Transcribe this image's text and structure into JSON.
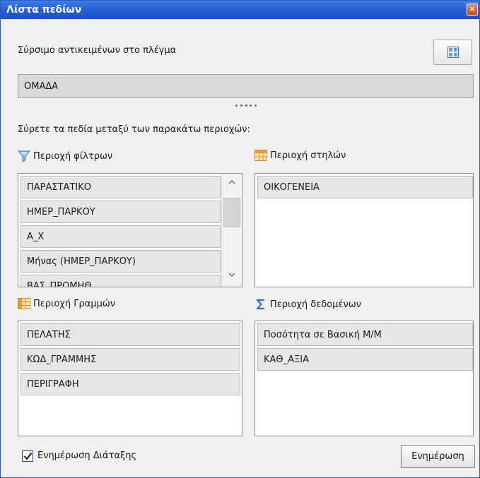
{
  "window": {
    "title": "Λίστα πεδίων",
    "close_label": "✕"
  },
  "header": {
    "drag_hint": "Σύρσιμο αντικειμένων στο πλέγμα",
    "layout_icon": "grid-layout-icon"
  },
  "field_list": {
    "items": [
      "ΟΜΑΔΑ"
    ]
  },
  "instructions": "Σύρετε τα πεδία μεταξύ των παρακάτω περιοχών:",
  "filter_area": {
    "title": "Περιοχή φίλτρων",
    "icon": "filter-funnel-icon",
    "items": [
      "ΠΑΡΑΣΤΑΤΙΚΟ",
      "ΗΜΕΡ_ΠΑΡΚΟΥ",
      "Α_Χ",
      "Μήνας (ΗΜΕΡ_ΠΑΡΚΟΥ)",
      "ΒΑΣ_ΠΡΟΜΗΘ"
    ]
  },
  "column_area": {
    "title": "Περιοχή στηλών",
    "icon": "columns-table-icon",
    "items": [
      "ΟΙΚΟΓΕΝΕΙΑ"
    ]
  },
  "row_area": {
    "title": "Περιοχή Γραμμών",
    "icon": "rows-table-icon",
    "items": [
      "ΠΕΛΑΤΗΣ",
      "ΚΩΔ_ΓΡΑΜΜΗΣ",
      "ΠΕΡΙΓΡΑΦΗ"
    ]
  },
  "data_area": {
    "title": "Περιοχή δεδομένων",
    "icon": "sigma-icon",
    "items": [
      "Ποσότητα σε Βασική Μ/Μ",
      "ΚΑΘ_ΑΞΙΑ"
    ]
  },
  "footer": {
    "defer_update_label": "Ενημέρωση Διάταξης",
    "defer_update_checked": true,
    "update_button_label": "Ενημέρωση"
  },
  "colors": {
    "title_bar": "#2761d6",
    "close_button": "#dd5a24",
    "field_item": "#e6e6e6"
  }
}
